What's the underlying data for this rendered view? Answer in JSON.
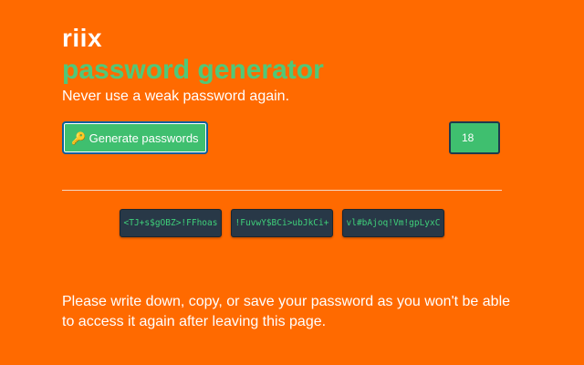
{
  "header": {
    "brand": "riix",
    "title": "password generator",
    "tagline": "Never use a weak password again."
  },
  "controls": {
    "generate_icon": "🔑",
    "generate_label": "Generate passwords",
    "length_value": "18"
  },
  "passwords": [
    "<TJ+s$gOBZ>!FFhoas",
    "!FuvwY$BCi>ubJkCi+",
    "vl#bAjoq!Vm!gpLyxC"
  ],
  "notice": "Please write down, copy, or save your password as you won't be able to access it again after leaving this page.",
  "colors": {
    "background": "#ff6a00",
    "accent": "#50c878",
    "password_bg": "#283847",
    "password_text": "#3fd07a"
  }
}
